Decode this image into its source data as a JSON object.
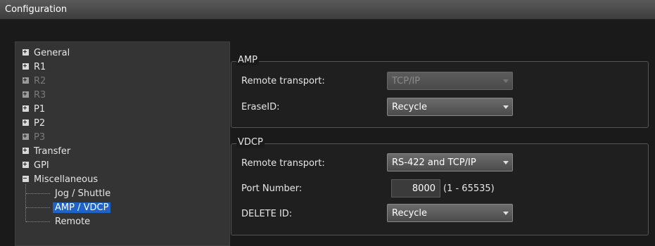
{
  "window": {
    "title": "Configuration"
  },
  "tree": {
    "items": [
      {
        "label": "General",
        "disabled": false
      },
      {
        "label": "R1",
        "disabled": false
      },
      {
        "label": "R2",
        "disabled": true
      },
      {
        "label": "R3",
        "disabled": true
      },
      {
        "label": "P1",
        "disabled": false
      },
      {
        "label": "P2",
        "disabled": false
      },
      {
        "label": "P3",
        "disabled": true
      },
      {
        "label": "Transfer",
        "disabled": false
      },
      {
        "label": "GPI",
        "disabled": false
      },
      {
        "label": "Miscellaneous",
        "disabled": false,
        "expanded": true
      }
    ],
    "children": [
      {
        "label": "Jog / Shuttle"
      },
      {
        "label": "AMP / VDCP",
        "selected": true
      },
      {
        "label": "Remote"
      }
    ]
  },
  "amp": {
    "legend": "AMP",
    "remote_transport_label": "Remote transport:",
    "remote_transport_value": "TCP/IP",
    "erase_id_label": "EraseID:",
    "erase_id_value": "Recycle"
  },
  "vdcp": {
    "legend": "VDCP",
    "remote_transport_label": "Remote transport:",
    "remote_transport_value": "RS-422 and TCP/IP",
    "port_number_label": "Port Number:",
    "port_number_value": "8000",
    "port_range": "(1 - 65535)",
    "delete_id_label": "DELETE ID:",
    "delete_id_value": "Recycle"
  },
  "colors": {
    "selection": "#1e63c6",
    "background": "#1a1a1a",
    "tree_background": "#343434"
  }
}
